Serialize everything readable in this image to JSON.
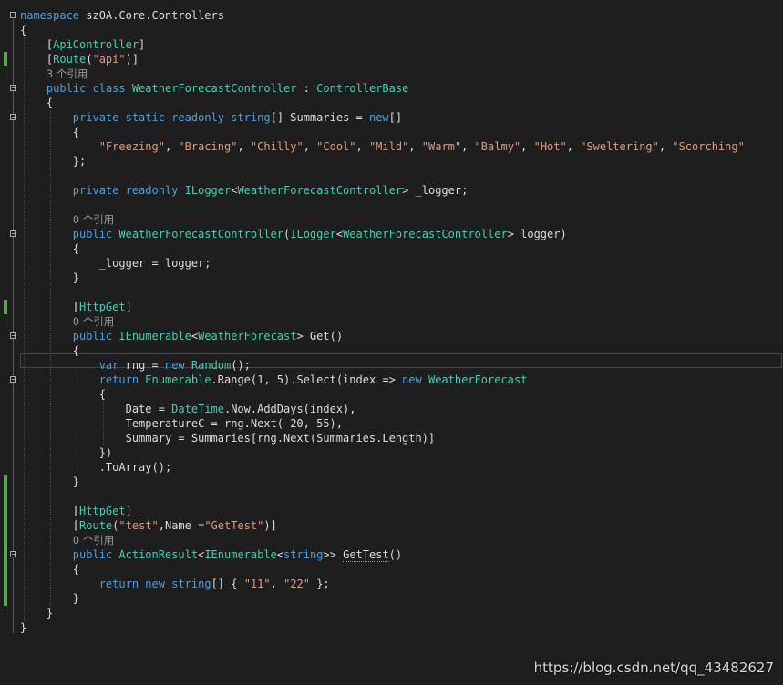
{
  "colors": {
    "background": "#1e1e1e",
    "keyword": "#569cd6",
    "type": "#4ec9b0",
    "string": "#d69d85",
    "plain": "#dcdcdc",
    "number": "#b5cea8",
    "lens": "#999999",
    "change_marker": "#57a64a"
  },
  "code_lines": [
    {
      "kind": "code",
      "fold": true,
      "tokens": [
        {
          "t": "namespace",
          "c": "kw"
        },
        {
          "t": " szOA.Core.Controllers",
          "c": "pl"
        }
      ]
    },
    {
      "kind": "code",
      "tokens": [
        {
          "t": "{",
          "c": "pl"
        }
      ]
    },
    {
      "kind": "code",
      "tokens": [
        {
          "t": "    [",
          "c": "pl"
        },
        {
          "t": "ApiController",
          "c": "ty"
        },
        {
          "t": "]",
          "c": "pl"
        }
      ]
    },
    {
      "kind": "code",
      "changed": true,
      "tokens": [
        {
          "t": "    [",
          "c": "pl"
        },
        {
          "t": "Route",
          "c": "ty"
        },
        {
          "t": "(",
          "c": "pl"
        },
        {
          "t": "\"api\"",
          "c": "st"
        },
        {
          "t": ")]",
          "c": "pl"
        }
      ]
    },
    {
      "kind": "lens",
      "indent": 4,
      "text": "3 个引用"
    },
    {
      "kind": "code",
      "fold": true,
      "tokens": [
        {
          "t": "    ",
          "c": "pl"
        },
        {
          "t": "public",
          "c": "kw"
        },
        {
          "t": " ",
          "c": "pl"
        },
        {
          "t": "class",
          "c": "kw"
        },
        {
          "t": " ",
          "c": "pl"
        },
        {
          "t": "WeatherForecastController",
          "c": "ty"
        },
        {
          "t": " : ",
          "c": "pl"
        },
        {
          "t": "ControllerBase",
          "c": "ty"
        }
      ]
    },
    {
      "kind": "code",
      "tokens": [
        {
          "t": "    {",
          "c": "pl"
        }
      ]
    },
    {
      "kind": "code",
      "fold": true,
      "tokens": [
        {
          "t": "        ",
          "c": "pl"
        },
        {
          "t": "private",
          "c": "kw"
        },
        {
          "t": " ",
          "c": "pl"
        },
        {
          "t": "static",
          "c": "kw"
        },
        {
          "t": " ",
          "c": "pl"
        },
        {
          "t": "readonly",
          "c": "kw"
        },
        {
          "t": " ",
          "c": "pl"
        },
        {
          "t": "string",
          "c": "kw"
        },
        {
          "t": "[] Summaries = ",
          "c": "pl"
        },
        {
          "t": "new",
          "c": "kw"
        },
        {
          "t": "[]",
          "c": "pl"
        }
      ]
    },
    {
      "kind": "code",
      "tokens": [
        {
          "t": "        {",
          "c": "pl"
        }
      ]
    },
    {
      "kind": "code",
      "tokens": [
        {
          "t": "            ",
          "c": "pl"
        },
        {
          "t": "\"Freezing\"",
          "c": "st"
        },
        {
          "t": ", ",
          "c": "pl"
        },
        {
          "t": "\"Bracing\"",
          "c": "st"
        },
        {
          "t": ", ",
          "c": "pl"
        },
        {
          "t": "\"Chilly\"",
          "c": "st"
        },
        {
          "t": ", ",
          "c": "pl"
        },
        {
          "t": "\"Cool\"",
          "c": "st"
        },
        {
          "t": ", ",
          "c": "pl"
        },
        {
          "t": "\"Mild\"",
          "c": "st"
        },
        {
          "t": ", ",
          "c": "pl"
        },
        {
          "t": "\"Warm\"",
          "c": "st"
        },
        {
          "t": ", ",
          "c": "pl"
        },
        {
          "t": "\"Balmy\"",
          "c": "st"
        },
        {
          "t": ", ",
          "c": "pl"
        },
        {
          "t": "\"Hot\"",
          "c": "st"
        },
        {
          "t": ", ",
          "c": "pl"
        },
        {
          "t": "\"Sweltering\"",
          "c": "st"
        },
        {
          "t": ", ",
          "c": "pl"
        },
        {
          "t": "\"Scorching\"",
          "c": "st"
        }
      ]
    },
    {
      "kind": "code",
      "tokens": [
        {
          "t": "        };",
          "c": "pl"
        }
      ]
    },
    {
      "kind": "blank"
    },
    {
      "kind": "code",
      "tokens": [
        {
          "t": "        ",
          "c": "pl"
        },
        {
          "t": "private",
          "c": "kw"
        },
        {
          "t": " ",
          "c": "pl"
        },
        {
          "t": "readonly",
          "c": "kw"
        },
        {
          "t": " ",
          "c": "pl"
        },
        {
          "t": "ILogger",
          "c": "ty"
        },
        {
          "t": "<",
          "c": "pl"
        },
        {
          "t": "WeatherForecastController",
          "c": "ty"
        },
        {
          "t": "> _logger;",
          "c": "pl"
        }
      ]
    },
    {
      "kind": "blank"
    },
    {
      "kind": "lens",
      "indent": 8,
      "text": "0 个引用"
    },
    {
      "kind": "code",
      "fold": true,
      "tokens": [
        {
          "t": "        ",
          "c": "pl"
        },
        {
          "t": "public",
          "c": "kw"
        },
        {
          "t": " ",
          "c": "pl"
        },
        {
          "t": "WeatherForecastController",
          "c": "ty"
        },
        {
          "t": "(",
          "c": "pl"
        },
        {
          "t": "ILogger",
          "c": "ty"
        },
        {
          "t": "<",
          "c": "pl"
        },
        {
          "t": "WeatherForecastController",
          "c": "ty"
        },
        {
          "t": "> logger)",
          "c": "pl"
        }
      ]
    },
    {
      "kind": "code",
      "tokens": [
        {
          "t": "        {",
          "c": "pl"
        }
      ]
    },
    {
      "kind": "code",
      "tokens": [
        {
          "t": "            _logger = logger;",
          "c": "pl"
        }
      ]
    },
    {
      "kind": "code",
      "tokens": [
        {
          "t": "        }",
          "c": "pl"
        }
      ]
    },
    {
      "kind": "blank"
    },
    {
      "kind": "code",
      "changed": true,
      "tokens": [
        {
          "t": "        [",
          "c": "pl"
        },
        {
          "t": "HttpGet",
          "c": "ty"
        },
        {
          "t": "]",
          "c": "pl"
        }
      ]
    },
    {
      "kind": "lens",
      "indent": 8,
      "text": "0 个引用"
    },
    {
      "kind": "code",
      "fold": true,
      "tokens": [
        {
          "t": "        ",
          "c": "pl"
        },
        {
          "t": "public",
          "c": "kw"
        },
        {
          "t": " ",
          "c": "pl"
        },
        {
          "t": "IEnumerable",
          "c": "ty"
        },
        {
          "t": "<",
          "c": "pl"
        },
        {
          "t": "WeatherForecast",
          "c": "ty"
        },
        {
          "t": "> Get()",
          "c": "pl"
        }
      ]
    },
    {
      "kind": "code",
      "tokens": [
        {
          "t": "        {",
          "c": "pl"
        }
      ]
    },
    {
      "kind": "code",
      "current": true,
      "tokens": [
        {
          "t": "            ",
          "c": "pl"
        },
        {
          "t": "var",
          "c": "kw"
        },
        {
          "t": " rng = ",
          "c": "pl"
        },
        {
          "t": "new",
          "c": "kw"
        },
        {
          "t": " ",
          "c": "pl"
        },
        {
          "t": "Random",
          "c": "ty"
        },
        {
          "t": "();",
          "c": "pl"
        }
      ]
    },
    {
      "kind": "code",
      "fold": true,
      "tokens": [
        {
          "t": "            ",
          "c": "pl"
        },
        {
          "t": "return",
          "c": "kw"
        },
        {
          "t": " ",
          "c": "pl"
        },
        {
          "t": "Enumerable",
          "c": "ty"
        },
        {
          "t": ".Range(1, 5).Select(index => ",
          "c": "pl"
        },
        {
          "t": "new",
          "c": "kw"
        },
        {
          "t": " ",
          "c": "pl"
        },
        {
          "t": "WeatherForecast",
          "c": "ty"
        }
      ]
    },
    {
      "kind": "code",
      "tokens": [
        {
          "t": "            {",
          "c": "pl"
        }
      ]
    },
    {
      "kind": "code",
      "tokens": [
        {
          "t": "                Date = ",
          "c": "pl"
        },
        {
          "t": "DateTime",
          "c": "ty"
        },
        {
          "t": ".Now.AddDays(index),",
          "c": "pl"
        }
      ]
    },
    {
      "kind": "code",
      "tokens": [
        {
          "t": "                TemperatureC = rng.Next(-20, 55),",
          "c": "pl"
        }
      ]
    },
    {
      "kind": "code",
      "tokens": [
        {
          "t": "                Summary = Summaries[rng.Next(Summaries.Length)]",
          "c": "pl"
        }
      ]
    },
    {
      "kind": "code",
      "tokens": [
        {
          "t": "            })",
          "c": "pl"
        }
      ]
    },
    {
      "kind": "code",
      "tokens": [
        {
          "t": "            .ToArray();",
          "c": "pl"
        }
      ]
    },
    {
      "kind": "code",
      "changed": true,
      "tokens": [
        {
          "t": "        }",
          "c": "pl"
        }
      ]
    },
    {
      "kind": "blank",
      "changed": true
    },
    {
      "kind": "code",
      "changed": true,
      "tokens": [
        {
          "t": "        [",
          "c": "pl"
        },
        {
          "t": "HttpGet",
          "c": "ty"
        },
        {
          "t": "]",
          "c": "pl"
        }
      ]
    },
    {
      "kind": "code",
      "changed": true,
      "tokens": [
        {
          "t": "        [",
          "c": "pl"
        },
        {
          "t": "Route",
          "c": "ty"
        },
        {
          "t": "(",
          "c": "pl"
        },
        {
          "t": "\"test\"",
          "c": "st"
        },
        {
          "t": ",Name =",
          "c": "pl"
        },
        {
          "t": "\"GetTest\"",
          "c": "st"
        },
        {
          "t": ")]",
          "c": "pl"
        }
      ]
    },
    {
      "kind": "lens",
      "indent": 8,
      "text": "0 个引用",
      "changed": true
    },
    {
      "kind": "code",
      "fold": true,
      "changed": true,
      "tokens": [
        {
          "t": "        ",
          "c": "pl"
        },
        {
          "t": "public",
          "c": "kw"
        },
        {
          "t": " ",
          "c": "pl"
        },
        {
          "t": "ActionResult",
          "c": "ty"
        },
        {
          "t": "<",
          "c": "pl"
        },
        {
          "t": "IEnumerable",
          "c": "ty"
        },
        {
          "t": "<",
          "c": "pl"
        },
        {
          "t": "string",
          "c": "kw"
        },
        {
          "t": ">> ",
          "c": "pl"
        },
        {
          "t": "GetTest",
          "c": "pl",
          "u": true
        },
        {
          "t": "()",
          "c": "pl"
        }
      ]
    },
    {
      "kind": "code",
      "changed": true,
      "tokens": [
        {
          "t": "        {",
          "c": "pl"
        }
      ]
    },
    {
      "kind": "code",
      "changed": true,
      "tokens": [
        {
          "t": "            ",
          "c": "pl"
        },
        {
          "t": "return",
          "c": "kw"
        },
        {
          "t": " ",
          "c": "pl"
        },
        {
          "t": "new",
          "c": "kw"
        },
        {
          "t": " ",
          "c": "pl"
        },
        {
          "t": "string",
          "c": "kw"
        },
        {
          "t": "[] { ",
          "c": "pl"
        },
        {
          "t": "\"11\"",
          "c": "st"
        },
        {
          "t": ", ",
          "c": "pl"
        },
        {
          "t": "\"22\"",
          "c": "st"
        },
        {
          "t": " };",
          "c": "pl"
        }
      ]
    },
    {
      "kind": "code",
      "changed": true,
      "tokens": [
        {
          "t": "        }",
          "c": "pl"
        }
      ]
    },
    {
      "kind": "code",
      "tokens": [
        {
          "t": "    }",
          "c": "pl"
        }
      ]
    },
    {
      "kind": "code",
      "tokens": [
        {
          "t": "}",
          "c": "pl"
        }
      ]
    }
  ],
  "watermark": "https://blog.csdn.net/qq_43482627"
}
